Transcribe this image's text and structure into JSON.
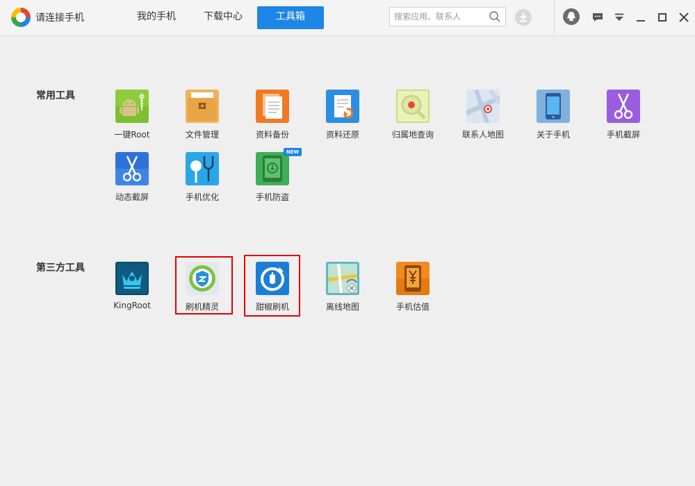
{
  "app": {
    "title": "请连接手机"
  },
  "nav": {
    "tabs": [
      {
        "label": "我的手机"
      },
      {
        "label": "下载中心"
      },
      {
        "label": "工具箱",
        "active": true
      }
    ]
  },
  "search": {
    "placeholder": "搜索应用、联系人",
    "icon": "search-icon"
  },
  "window_controls": [
    "qq-icon",
    "message-icon",
    "dropdown-icon",
    "minimize-icon",
    "maximize-icon",
    "close-icon"
  ],
  "sections": {
    "common": {
      "title": "常用工具",
      "tools": [
        {
          "label": "一键Root",
          "icon": "android-root-icon"
        },
        {
          "label": "文件管理",
          "icon": "folder-icon"
        },
        {
          "label": "资料备份",
          "icon": "backup-icon"
        },
        {
          "label": "资料还原",
          "icon": "restore-icon"
        },
        {
          "label": "归属地查询",
          "icon": "location-search-icon"
        },
        {
          "label": "联系人地图",
          "icon": "contact-map-icon"
        },
        {
          "label": "关于手机",
          "icon": "phone-info-icon"
        },
        {
          "label": "手机截屏",
          "icon": "scissors-icon"
        },
        {
          "label": "动态截屏",
          "icon": "scissors-dynamic-icon"
        },
        {
          "label": "手机优化",
          "icon": "stethoscope-icon"
        },
        {
          "label": "手机防盗",
          "icon": "anti-theft-icon",
          "badge": "NEW"
        }
      ]
    },
    "third_party": {
      "title": "第三方工具",
      "tools": [
        {
          "label": "KingRoot",
          "icon": "kingroot-icon"
        },
        {
          "label": "刷机精灵",
          "icon": "shuaji-jingling-icon",
          "highlighted": true
        },
        {
          "label": "甜椒刷机",
          "icon": "tianjiao-shuaji-icon",
          "highlighted": true
        },
        {
          "label": "离线地图",
          "icon": "offline-map-icon"
        },
        {
          "label": "手机估值",
          "icon": "phone-valuation-icon"
        }
      ]
    }
  },
  "colors": {
    "accent": "#1e86e6",
    "highlight": "#e00000",
    "background": "#efefef"
  }
}
